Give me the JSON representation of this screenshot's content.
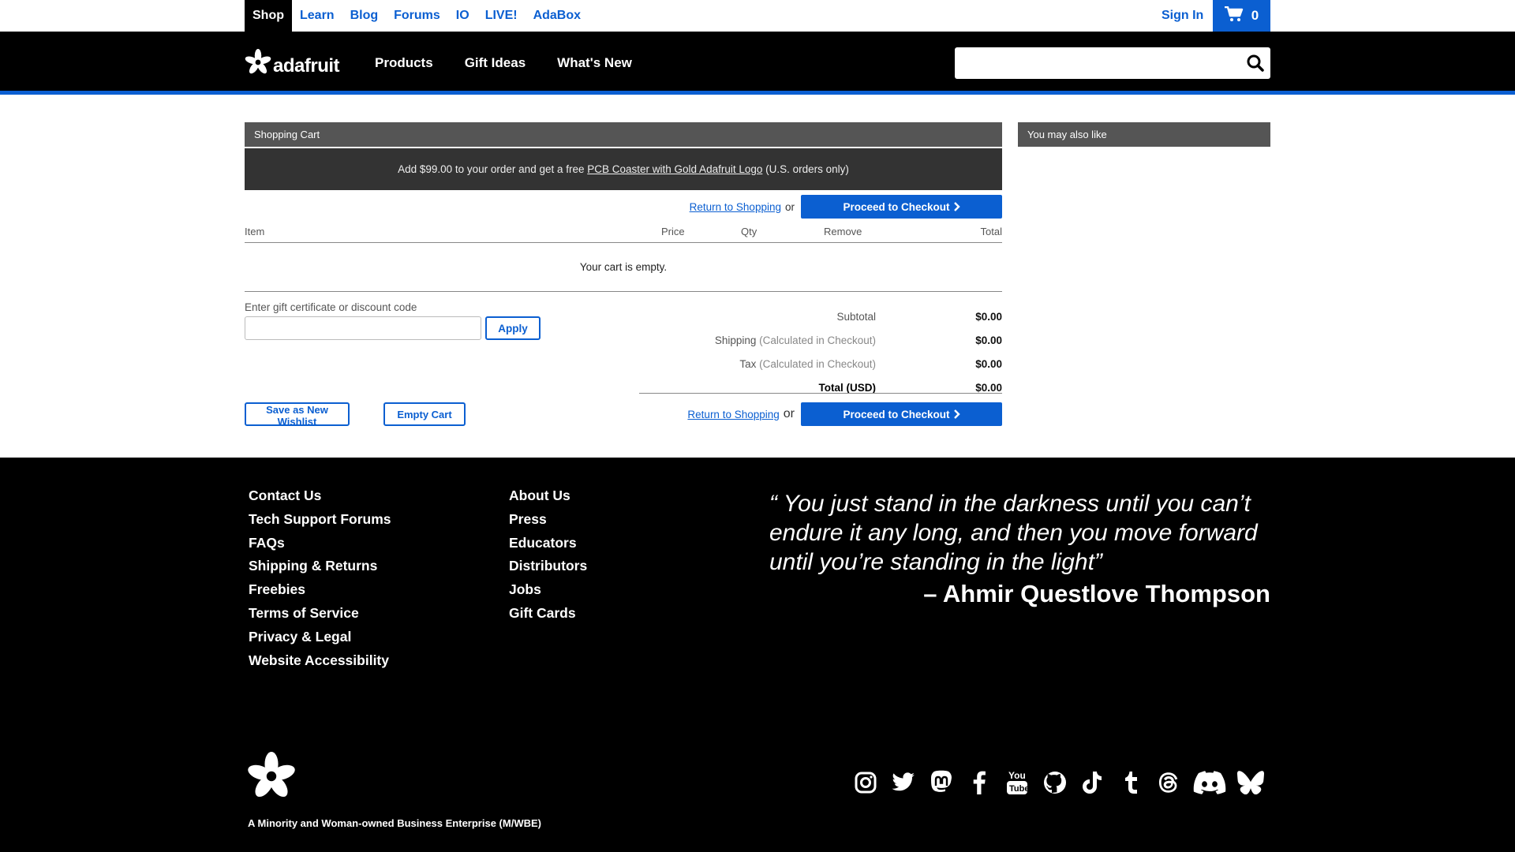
{
  "topnav": {
    "items": [
      "Shop",
      "Learn",
      "Blog",
      "Forums",
      "IO",
      "LIVE!",
      "AdaBox"
    ],
    "sign_in": "Sign In",
    "cart_count": "0"
  },
  "header": {
    "logo_text": "adafruit",
    "nav": [
      "Products",
      "Gift Ideas",
      "What's New"
    ],
    "search_placeholder": ""
  },
  "cart": {
    "title": "Shopping Cart",
    "promo_prefix": "Add $99.00 to your order and get a free ",
    "promo_link": "PCB Coaster with Gold Adafruit Logo",
    "promo_suffix": " (U.S. orders only)",
    "return_link": "Return to Shopping",
    "or": "or",
    "checkout": "Proceed to Checkout",
    "columns": {
      "item": "Item",
      "price": "Price",
      "qty": "Qty",
      "remove": "Remove",
      "total": "Total"
    },
    "empty_message": "Your cart is empty.",
    "gift_label": "Enter gift certificate or discount code",
    "gift_value": "",
    "apply": "Apply",
    "totals": {
      "subtotal_label": "Subtotal",
      "subtotal": "$0.00",
      "shipping_label": "Shipping",
      "shipping_note": "(Calculated in Checkout)",
      "shipping": "$0.00",
      "tax_label": "Tax",
      "tax_note": "(Calculated in Checkout)",
      "tax": "$0.00",
      "total_label": "Total (USD)",
      "total": "$0.00"
    },
    "save_wishlist": "Save as New Wishlist",
    "empty_cart": "Empty Cart"
  },
  "side": {
    "title": "You may also like"
  },
  "footer": {
    "col1": [
      "Contact Us",
      "Tech Support Forums",
      "FAQs",
      "Shipping & Returns",
      "Freebies",
      "Terms of Service",
      "Privacy & Legal",
      "Website Accessibility"
    ],
    "col2": [
      "About Us",
      "Press",
      "Educators",
      "Distributors",
      "Jobs",
      "Gift Cards"
    ],
    "quote": "“ You just stand in the darkness until you can’t endure it any long, and then you move forward until you’re standing in the light”",
    "quote_author": "– Ahmir Questlove Thompson",
    "mwbe": "A Minority and Woman-owned Business Enterprise (M/WBE)",
    "social": [
      "instagram-icon",
      "twitter-icon",
      "mastodon-icon",
      "facebook-icon",
      "youtube-icon",
      "github-icon",
      "tiktok-icon",
      "tumblr-icon",
      "threads-icon",
      "discord-icon",
      "bluesky-icon"
    ]
  },
  "colors": {
    "accent": "#0b5fd1",
    "header_bg": "#000000",
    "panel_title_bg": "#555555",
    "promo_bg": "#333333"
  }
}
